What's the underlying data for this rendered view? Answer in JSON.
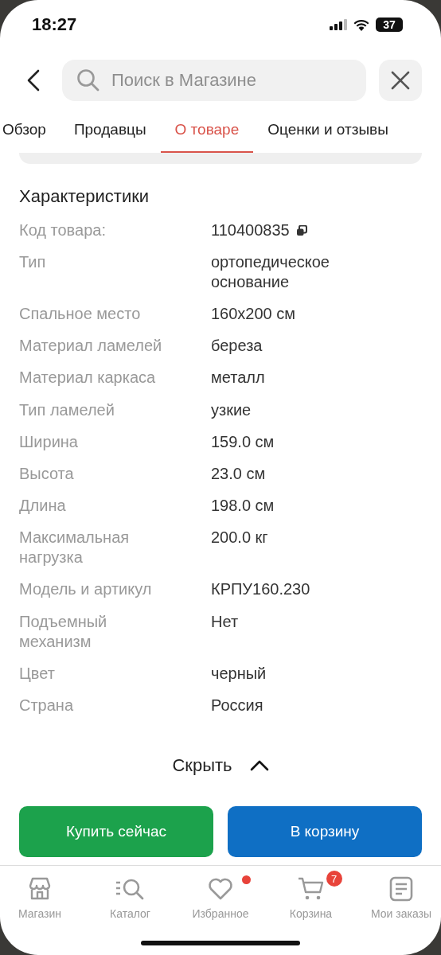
{
  "status_bar": {
    "time": "18:27",
    "battery": "37"
  },
  "search": {
    "placeholder": "Поиск в Магазине"
  },
  "tabs": [
    {
      "label": "Обзор",
      "selected": false
    },
    {
      "label": "Продавцы",
      "selected": false
    },
    {
      "label": "О товаре",
      "selected": true
    },
    {
      "label": "Оценки и отзывы",
      "selected": false
    }
  ],
  "section_title": "Характеристики",
  "specs": [
    {
      "label": "Код товара:",
      "value": "110400835",
      "copyable": true
    },
    {
      "label": "Тип",
      "value": "ортопедическое основание",
      "copyable": false
    },
    {
      "label": "Спальное место",
      "value": "160x200 см",
      "copyable": false
    },
    {
      "label": "Материал ламелей",
      "value": "береза",
      "copyable": false
    },
    {
      "label": "Материал каркаса",
      "value": "металл",
      "copyable": false
    },
    {
      "label": "Тип ламелей",
      "value": "узкие",
      "copyable": false
    },
    {
      "label": "Ширина",
      "value": "159.0 см",
      "copyable": false
    },
    {
      "label": "Высота",
      "value": "23.0 см",
      "copyable": false
    },
    {
      "label": "Длина",
      "value": "198.0 см",
      "copyable": false
    },
    {
      "label": "Максимальная нагрузка",
      "value": "200.0 кг",
      "copyable": false
    },
    {
      "label": "Модель и артикул",
      "value": "КРПУ160.230",
      "copyable": false
    },
    {
      "label": "Подъемный механизм",
      "value": "Нет",
      "copyable": false
    },
    {
      "label": "Цвет",
      "value": "черный",
      "copyable": false
    },
    {
      "label": "Страна",
      "value": "Россия",
      "copyable": false
    }
  ],
  "collapse_link": "Скрыть",
  "buttons": [
    {
      "label": "Купить сейчас",
      "kind": "buy"
    },
    {
      "label": "В корзину",
      "kind": "cart"
    }
  ],
  "nav": [
    {
      "label": "Магазин",
      "kind": "store",
      "dot": false
    },
    {
      "label": "Каталог",
      "kind": "catalog",
      "dot": false
    },
    {
      "label": "Избранное",
      "kind": "heart",
      "dot": true
    },
    {
      "label": "Корзина",
      "kind": "cart",
      "dot": false,
      "badge": "7"
    },
    {
      "label": "Мои заказы",
      "kind": "orders",
      "dot": false
    }
  ]
}
